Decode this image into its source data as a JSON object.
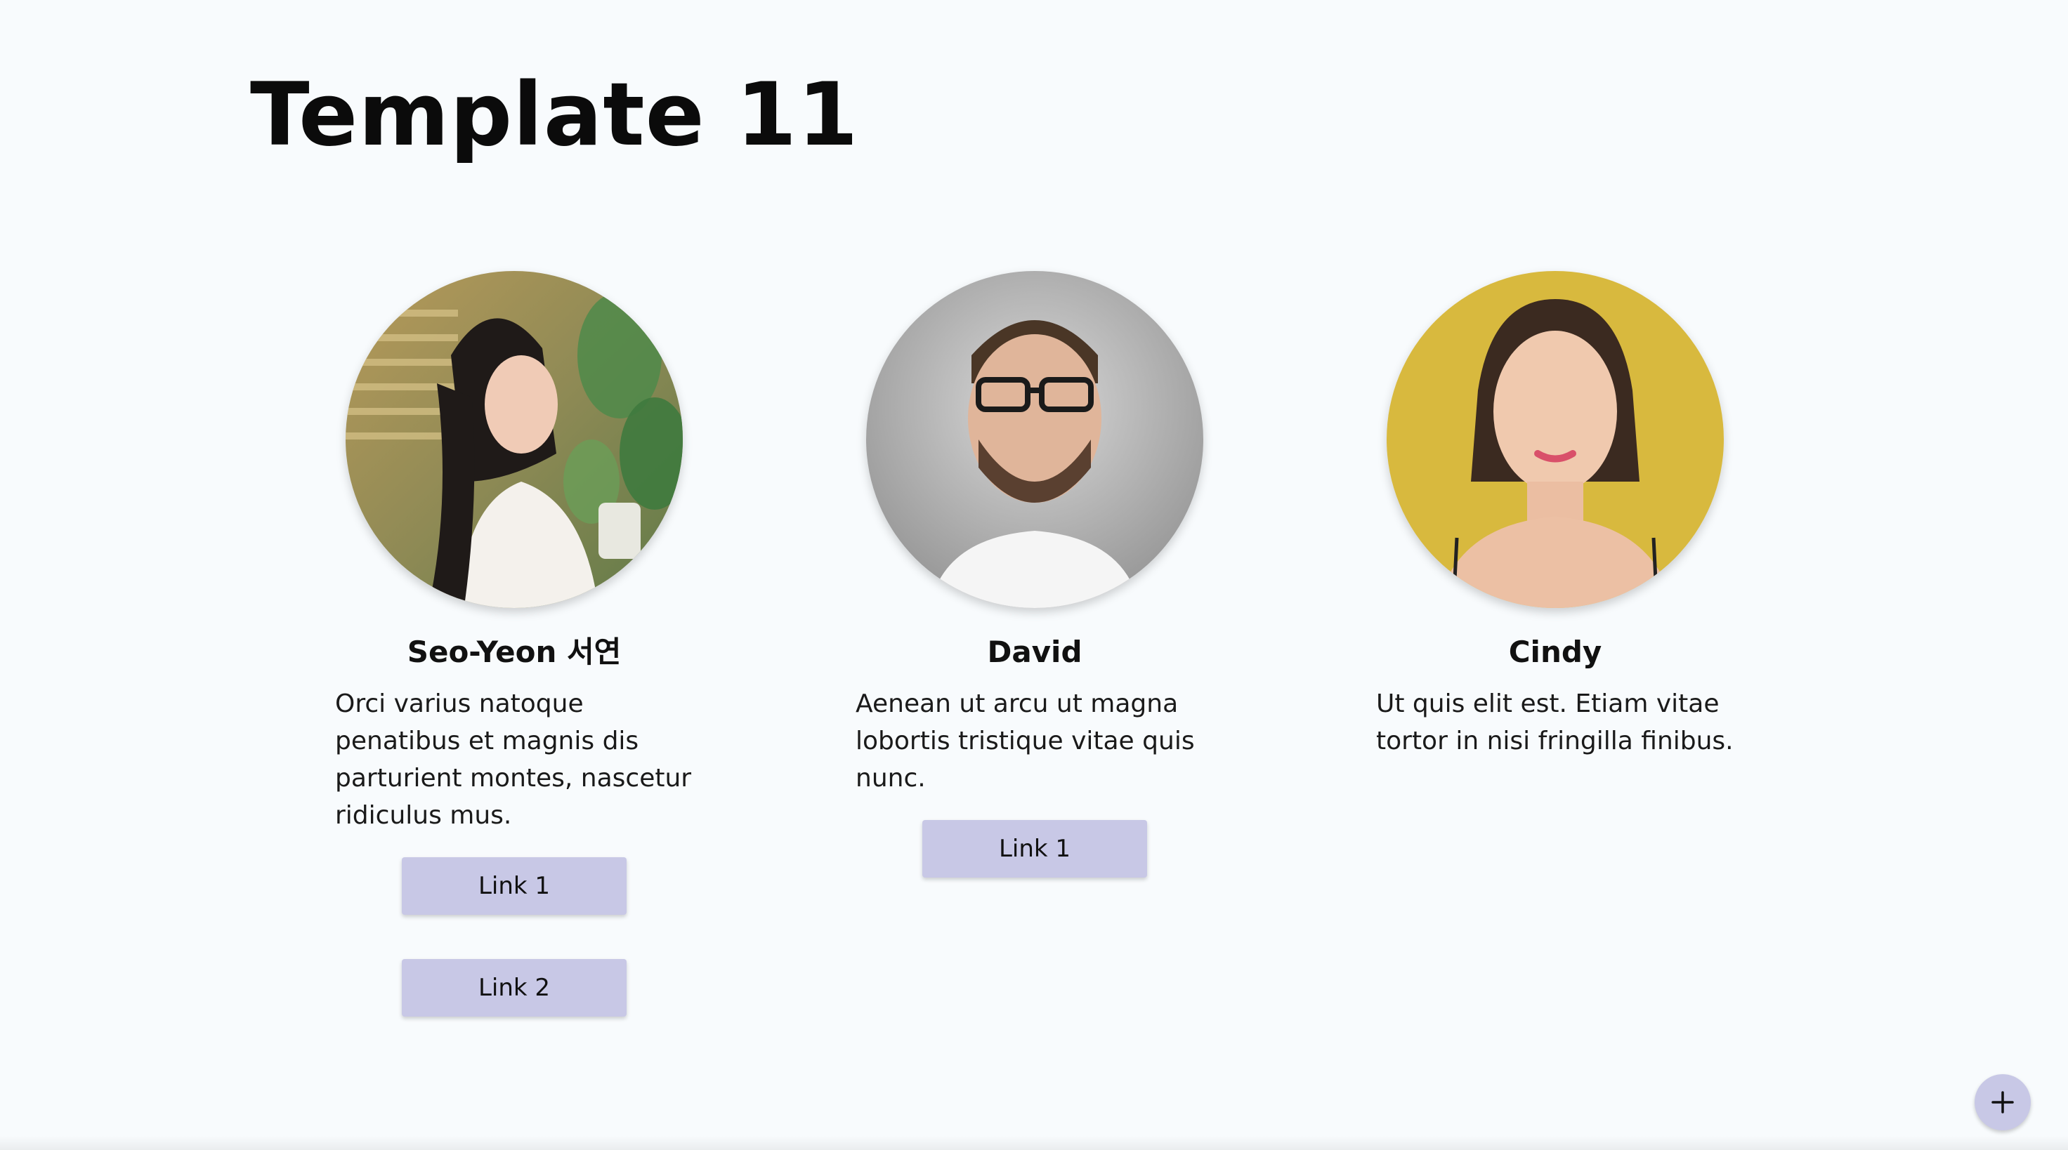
{
  "page": {
    "title": "Template 11"
  },
  "cards": [
    {
      "name": "Seo-Yeon 서연",
      "text": "Orci varius natoque penatibus et magnis dis parturient montes, nascetur ridiculus mus.",
      "links": [
        "Link 1",
        "Link 2"
      ]
    },
    {
      "name": "David",
      "text": "Aenean ut arcu ut magna lobortis tristique vitae quis nunc.",
      "links": [
        "Link 1"
      ]
    },
    {
      "name": "Cindy",
      "text": "Ut quis elit est. Etiam vitae tortor in nisi fringilla finibus.",
      "links": []
    }
  ],
  "fab": {
    "icon": "plus-icon"
  },
  "colors": {
    "background": "#f8fbfd",
    "button": "#c8c8e6",
    "text": "#111111"
  }
}
